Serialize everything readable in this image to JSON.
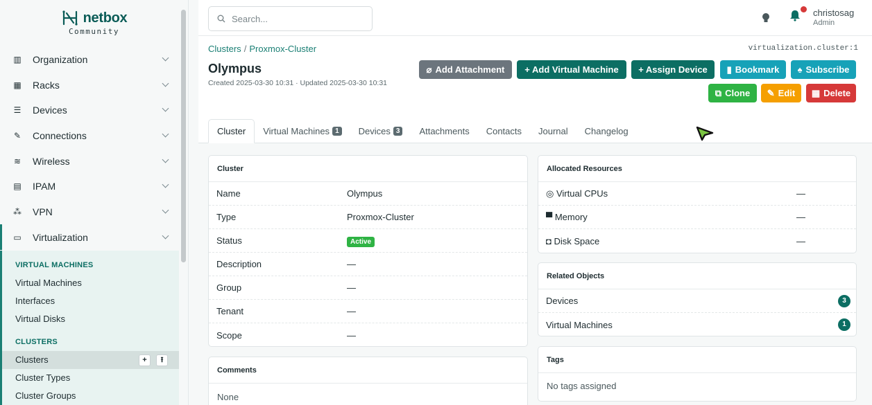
{
  "brand": {
    "name": "netbox",
    "edition": "Community"
  },
  "nav": [
    {
      "label": "Organization",
      "icon": "building-icon",
      "glyph": "▥"
    },
    {
      "label": "Racks",
      "icon": "rack-icon",
      "glyph": "▦"
    },
    {
      "label": "Devices",
      "icon": "server-icon",
      "glyph": "☰"
    },
    {
      "label": "Connections",
      "icon": "plug-icon",
      "glyph": "✎"
    },
    {
      "label": "Wireless",
      "icon": "wifi-icon",
      "glyph": "≋"
    },
    {
      "label": "IPAM",
      "icon": "counter-icon",
      "glyph": "▤"
    },
    {
      "label": "VPN",
      "icon": "tunnel-icon",
      "glyph": "⁂"
    },
    {
      "label": "Virtualization",
      "icon": "monitor-icon",
      "glyph": "▭"
    }
  ],
  "subnav": {
    "vm_heading": "VIRTUAL MACHINES",
    "vm_links": [
      "Virtual Machines",
      "Interfaces",
      "Virtual Disks"
    ],
    "cluster_heading": "CLUSTERS",
    "cluster_links": [
      "Clusters",
      "Cluster Types",
      "Cluster Groups"
    ],
    "add_label": "+",
    "import_label": "⭱"
  },
  "header": {
    "search_placeholder": "Search...",
    "user_name": "christosag",
    "user_role": "Admin"
  },
  "page": {
    "breadcrumb_parent": "Clusters",
    "breadcrumb_separator": "/",
    "breadcrumb_current": "Proxmox-Cluster",
    "object_id": "virtualization.cluster:1",
    "title": "Olympus",
    "meta": "Created 2025-03-30 10:31 · Updated 2025-03-30 10:31"
  },
  "actions": {
    "add_attachment": "Add Attachment",
    "add_vm": "+ Add Virtual Machine",
    "assign_device": "+ Assign Device",
    "bookmark": "Bookmark",
    "subscribe": "Subscribe",
    "clone": "Clone",
    "edit": "Edit",
    "delete": "Delete"
  },
  "tabs": [
    {
      "label": "Cluster",
      "count": null
    },
    {
      "label": "Virtual Machines",
      "count": "1"
    },
    {
      "label": "Devices",
      "count": "3"
    },
    {
      "label": "Attachments",
      "count": null
    },
    {
      "label": "Contacts",
      "count": null
    },
    {
      "label": "Journal",
      "count": null
    },
    {
      "label": "Changelog",
      "count": null
    }
  ],
  "cluster_card": {
    "title": "Cluster",
    "rows": [
      {
        "key": "Name",
        "value": "Olympus"
      },
      {
        "key": "Type",
        "value": "Proxmox-Cluster"
      },
      {
        "key": "Status",
        "value": "Active"
      },
      {
        "key": "Description",
        "value": "—"
      },
      {
        "key": "Group",
        "value": "—"
      },
      {
        "key": "Tenant",
        "value": "—"
      },
      {
        "key": "Scope",
        "value": "—"
      }
    ]
  },
  "comments_card": {
    "title": "Comments",
    "value": "None"
  },
  "resources_card": {
    "title": "Allocated Resources",
    "rows": [
      {
        "key": "Virtual CPUs",
        "icon": "cpu-icon",
        "glyph": "◎",
        "value": "—"
      },
      {
        "key": "Memory",
        "icon": "memory-icon",
        "glyph": "▀",
        "value": "—"
      },
      {
        "key": "Disk Space",
        "icon": "harddisk-icon",
        "glyph": "◘",
        "value": "—"
      }
    ]
  },
  "related_card": {
    "title": "Related Objects",
    "rows": [
      {
        "key": "Devices",
        "count": "3"
      },
      {
        "key": "Virtual Machines",
        "count": "1"
      }
    ]
  },
  "tags_card": {
    "title": "Tags",
    "value": "No tags assigned"
  },
  "colors": {
    "accent": "#1a7f74",
    "primary_dark": "#0c6e63",
    "secondary": "#6c757d",
    "info": "#17a2b8",
    "success": "#2fb344",
    "warning": "#f59f00",
    "danger": "#d63939"
  }
}
